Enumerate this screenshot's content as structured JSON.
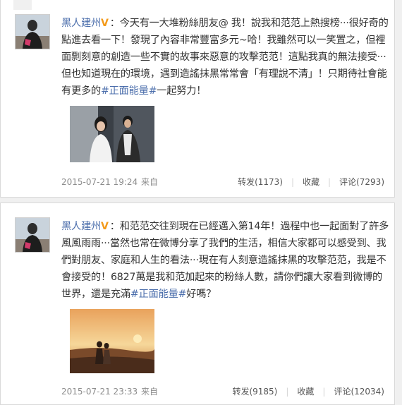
{
  "posts": [
    {
      "username": "黑人建州",
      "verified_badge": "V",
      "segments": [
        {
          "text": "：今天有一大堆粉絲朋友@ 我！說我和范范上熱搜榜···很好奇的點進去看一下！發現了內容非常豐富多元~哈！我雖然可以一笑置之，但裡面剽刻意的創造一些不實的故事來惡意的攻擊范范！這點我真的無法接受···但也知道現在的環境，遇到造謠抹黑常常會「有理說不清」！只期待社會能有更多的",
          "hashtag": false
        },
        {
          "text": "#正面能量#",
          "hashtag": true
        },
        {
          "text": "一起努力！",
          "hashtag": false
        }
      ],
      "timestamp": "2015-07-21 19:24",
      "source": "来自",
      "actions": {
        "repost": "转发(1173)",
        "favorite": "收藏",
        "comment": "评论(7293)"
      }
    },
    {
      "username": "黑人建州",
      "verified_badge": "V",
      "segments": [
        {
          "text": "：和范范交往到現在已經邁入第14年！過程中也一起面對了許多風風雨雨···當然也常在微博分享了我們的生活，相信大家都可以感受到、我們對朋友、家庭和人生的看法···現在有人刻意造謠抹黑的攻擊范范，我是不會接受的！6827萬是我和范加起來的粉絲人數，請你們讓大家看到微博的世界，還是充滿",
          "hashtag": false
        },
        {
          "text": "#正面能量#",
          "hashtag": true
        },
        {
          "text": "好嗎？",
          "hashtag": false
        }
      ],
      "timestamp": "2015-07-21 23:33",
      "source": "来自",
      "actions": {
        "repost": "转发(9185)",
        "favorite": "收藏",
        "comment": "评论(12034)"
      }
    }
  ],
  "colors": {
    "link": "#4a6dab",
    "badge": "#f39a1a",
    "meta": "#8c8c8c"
  }
}
